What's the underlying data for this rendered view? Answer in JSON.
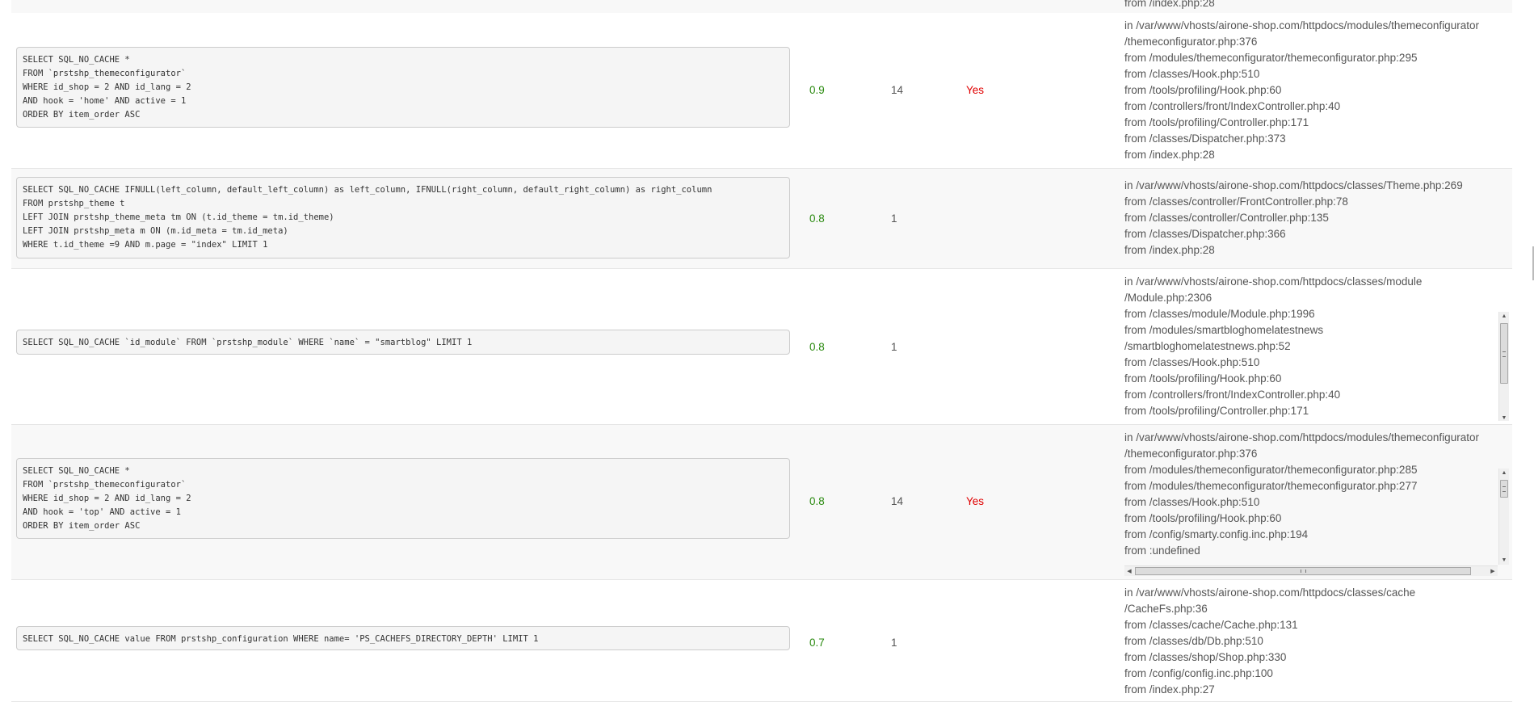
{
  "top_partial": {
    "stack_text": "from /index.php:28"
  },
  "rows": [
    {
      "sql": "SELECT SQL_NO_CACHE *\nFROM `prstshp_themeconfigurator`\nWHERE id_shop = 2 AND id_lang = 2\nAND hook = 'home' AND active = 1\nORDER BY item_order ASC",
      "time": "0.9",
      "rows": "14",
      "filesort": "Yes",
      "stack": [
        "in /var/www/vhosts/airone-shop.com/httpdocs/modules/themeconfigurator",
        "/themeconfigurator.php:376",
        "from /modules/themeconfigurator/themeconfigurator.php:295",
        "from /classes/Hook.php:510",
        "from /tools/profiling/Hook.php:60",
        "from /controllers/front/IndexController.php:40",
        "from /tools/profiling/Controller.php:171",
        "from /classes/Dispatcher.php:373",
        "from /index.php:28"
      ]
    },
    {
      "sql": "SELECT SQL_NO_CACHE IFNULL(left_column, default_left_column) as left_column, IFNULL(right_column, default_right_column) as right_column\nFROM prstshp_theme t\nLEFT JOIN prstshp_theme_meta tm ON (t.id_theme = tm.id_theme)\nLEFT JOIN prstshp_meta m ON (m.id_meta = tm.id_meta)\nWHERE t.id_theme =9 AND m.page = \"index\" LIMIT 1",
      "time": "0.8",
      "rows": "1",
      "filesort": "",
      "stack": [
        "in /var/www/vhosts/airone-shop.com/httpdocs/classes/Theme.php:269",
        "from /classes/controller/FrontController.php:78",
        "from /classes/controller/Controller.php:135",
        "from /classes/Dispatcher.php:366",
        "from /index.php:28"
      ]
    },
    {
      "sql": "SELECT SQL_NO_CACHE `id_module` FROM `prstshp_module` WHERE `name` = \"smartblog\" LIMIT 1",
      "time": "0.8",
      "rows": "1",
      "filesort": "",
      "stack": [
        "in /var/www/vhosts/airone-shop.com/httpdocs/classes/module",
        "/Module.php:2306",
        "from /classes/module/Module.php:1996",
        "from /modules/smartbloghomelatestnews",
        "/smartbloghomelatestnews.php:52",
        "from /classes/Hook.php:510",
        "from /tools/profiling/Hook.php:60",
        "from /controllers/front/IndexController.php:40",
        "from /tools/profiling/Controller.php:171"
      ]
    },
    {
      "sql": "SELECT SQL_NO_CACHE *\nFROM `prstshp_themeconfigurator`\nWHERE id_shop = 2 AND id_lang = 2\nAND hook = 'top' AND active = 1\nORDER BY item_order ASC",
      "time": "0.8",
      "rows": "14",
      "filesort": "Yes",
      "stack": [
        "in /var/www/vhosts/airone-shop.com/httpdocs/modules/themeconfigurator",
        "/themeconfigurator.php:376",
        "from /modules/themeconfigurator/themeconfigurator.php:285",
        "from /modules/themeconfigurator/themeconfigurator.php:277",
        "from /classes/Hook.php:510",
        "from /tools/profiling/Hook.php:60",
        "from /config/smarty.config.inc.php:194",
        "from :undefined"
      ]
    },
    {
      "sql": "SELECT SQL_NO_CACHE value FROM prstshp_configuration WHERE name= 'PS_CACHEFS_DIRECTORY_DEPTH' LIMIT 1",
      "time": "0.7",
      "rows": "1",
      "filesort": "",
      "stack": [
        "in /var/www/vhosts/airone-shop.com/httpdocs/classes/cache",
        "/CacheFs.php:36",
        "from /classes/cache/Cache.php:131",
        "from /classes/db/Db.php:510",
        "from /classes/shop/Shop.php:330",
        "from /config/config.inc.php:100",
        "from /index.php:27"
      ]
    }
  ],
  "scrollbars": {
    "up_arrow_icon": "triangle-up",
    "down_arrow_icon": "triangle-down",
    "left_arrow_icon": "triangle-left",
    "right_arrow_icon": "triangle-right"
  }
}
